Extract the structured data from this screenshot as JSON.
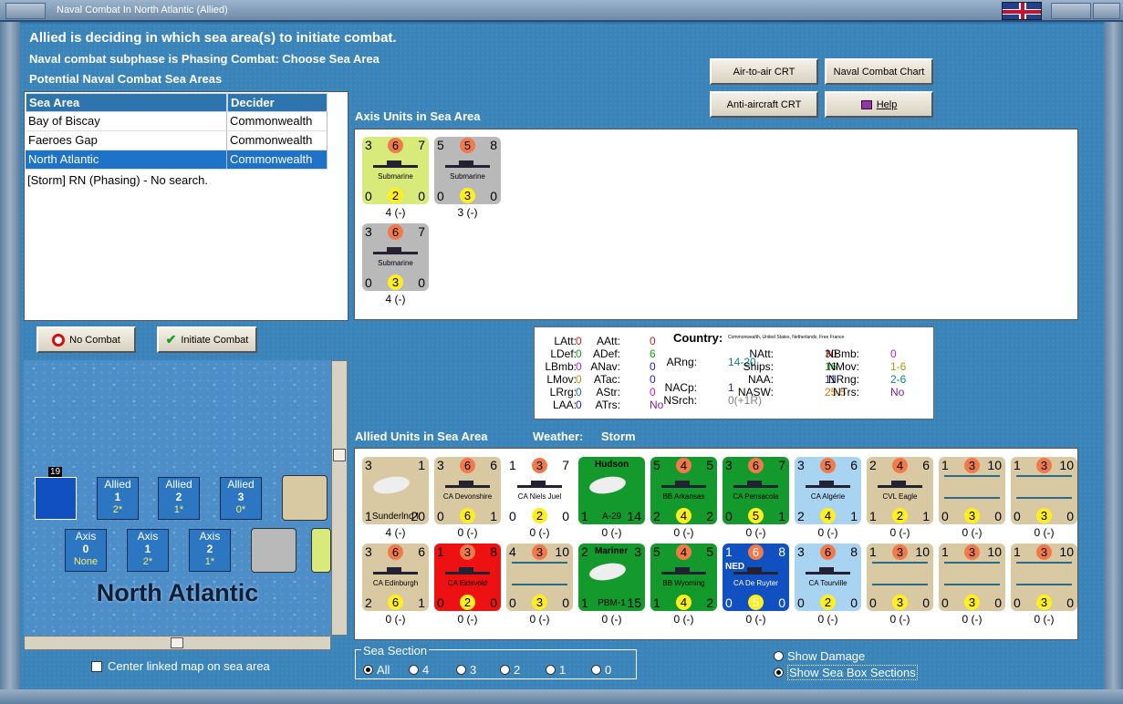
{
  "window": {
    "title": "Naval Combat In North Atlantic (Allied)"
  },
  "header": {
    "line1": "Allied is deciding in which sea area(s) to initiate combat.",
    "line2": "Naval combat subphase is Phasing Combat: Choose Sea Area",
    "line3": "Potential Naval Combat Sea Areas"
  },
  "sea_table": {
    "headers": [
      "Sea Area",
      "Decider"
    ],
    "rows": [
      [
        "Bay of Biscay",
        "Commonwealth"
      ],
      [
        "Faeroes Gap",
        "Commonwealth"
      ],
      [
        "North Atlantic",
        "Commonwealth"
      ]
    ],
    "selected": 2,
    "note": "[Storm]  RN (Phasing) - No search."
  },
  "buttons": {
    "air_crt": "Air-to-air CRT",
    "naval_chart": "Naval Combat Chart",
    "aa_crt": "Anti-aircraft CRT",
    "help": "Help",
    "no_combat": "No Combat",
    "initiate": "Initiate Combat"
  },
  "axis": {
    "label": "Axis Units in Sea Area",
    "units": [
      {
        "tl": "3",
        "tc": "6",
        "tr": "7",
        "name": "Submarine",
        "bl": "0",
        "bc": "2",
        "br": "0",
        "status": "4 (-)",
        "color": "#d8ea7a"
      },
      {
        "tl": "5",
        "tc": "5",
        "tr": "8",
        "name": "Submarine",
        "bl": "0",
        "bc": "3",
        "br": "0",
        "status": "3 (-)",
        "color": "#b9b9b9"
      },
      {
        "tl": "3",
        "tc": "6",
        "tr": "7",
        "name": "Submarine",
        "bl": "0",
        "bc": "3",
        "br": "0",
        "status": "4 (-)",
        "color": "#b9b9b9"
      }
    ]
  },
  "info": {
    "country_label": "Country:",
    "country": "Commonwealth, United States, Netherlands, Free France",
    "stats": [
      {
        "k": "LAtt:",
        "v": "0",
        "c": "#d02020"
      },
      {
        "k": "LDef:",
        "v": "0",
        "c": "#10a010"
      },
      {
        "k": "LBmb:",
        "v": "0",
        "c": "#c020c0"
      },
      {
        "k": "LMov:",
        "v": "0",
        "c": "#a0a010"
      },
      {
        "k": "LRrg:",
        "v": "0",
        "c": "#108080"
      },
      {
        "k": "LAA:",
        "v": "0",
        "c": "#2020c0"
      },
      {
        "k": "AAtt:",
        "v": "0",
        "c": "#d02020"
      },
      {
        "k": "ADef:",
        "v": "6",
        "c": "#10a010"
      },
      {
        "k": "ANav:",
        "v": "0",
        "c": "#2020c0"
      },
      {
        "k": "ATac:",
        "v": "0",
        "c": "#2020c0"
      },
      {
        "k": "AStr:",
        "v": "0",
        "c": "#c020c0"
      },
      {
        "k": "ATrs:",
        "v": "No",
        "c": "#8020a0"
      },
      {
        "k": "ARng:",
        "v": "14-20",
        "c": "#108080"
      },
      {
        "k": "NACp:",
        "v": "1",
        "c": "#2020c0"
      },
      {
        "k": "NSrch:",
        "v": "0(+1R)",
        "c": "#808080"
      },
      {
        "k": "NAtt:",
        "v": "30",
        "c": "#d02020"
      },
      {
        "k": "Ships:",
        "v": "16",
        "c": "#10a010"
      },
      {
        "k": "NAA:",
        "v": "11",
        "c": "#2020c0"
      },
      {
        "k": "NASW:",
        "v": "25.5",
        "c": "#e07010"
      },
      {
        "k": "NBmb:",
        "v": "0",
        "c": "#c020c0"
      },
      {
        "k": "NMov:",
        "v": "1-6",
        "c": "#a0a010"
      },
      {
        "k": "NRng:",
        "v": "2-6",
        "c": "#108080"
      },
      {
        "k": "NTrs:",
        "v": "No",
        "c": "#8020a0"
      }
    ]
  },
  "allied": {
    "label": "Allied Units in Sea Area",
    "weather_label": "Weather:",
    "weather": "Storm",
    "units": [
      {
        "tl": "3",
        "tc": "",
        "tr": "1",
        "name": "Sunderlnd I",
        "bl": "1",
        "bc": "",
        "br": "20",
        "status": "4 (-)",
        "color": "#d9c9a3",
        "type": "air"
      },
      {
        "tl": "3",
        "tc": "6",
        "tr": "6",
        "name": "CA Devonshire",
        "bl": "0",
        "bc": "6",
        "br": "1",
        "status": "0 (-)",
        "color": "#d9c9a3"
      },
      {
        "tl": "1",
        "tc": "3",
        "tr": "7",
        "name": "CA Niels Juel",
        "bl": "0",
        "bc": "2",
        "br": "0",
        "status": "0 (-)",
        "color": "#ffffff"
      },
      {
        "tl": "",
        "tc": "Hudson",
        "tr": "",
        "name": "A-29",
        "bl": "1",
        "bc": "",
        "br": "14",
        "status": "0 (-)",
        "color": "#149a2c",
        "type": "air"
      },
      {
        "tl": "5",
        "tc": "4",
        "tr": "5",
        "name": "BB Arkansas",
        "bl": "2",
        "bc": "4",
        "br": "2",
        "status": "0 (-)",
        "color": "#149a2c"
      },
      {
        "tl": "3",
        "tc": "6",
        "tr": "7",
        "name": "CA Pensacola",
        "bl": "0",
        "bc": "5",
        "br": "1",
        "status": "0 (-)",
        "color": "#149a2c"
      },
      {
        "tl": "3",
        "tc": "5",
        "tr": "6",
        "name": "CA Algérie",
        "bl": "2",
        "bc": "4",
        "br": "1",
        "status": "0 (-)",
        "color": "#a8d4f2"
      },
      {
        "tl": "2",
        "tc": "4",
        "tr": "6",
        "name": "CVL Eagle",
        "bl": "1",
        "bc": "2",
        "br": "1",
        "status": "0 (-)",
        "color": "#d9c9a3"
      },
      {
        "tl": "1",
        "tc": "3",
        "tr": "10",
        "name": "",
        "bl": "0",
        "bc": "3",
        "br": "0",
        "status": "0 (-)",
        "color": "#d9c9a3",
        "type": "conv"
      },
      {
        "tl": "1",
        "tc": "3",
        "tr": "10",
        "name": "",
        "bl": "0",
        "bc": "3",
        "br": "0",
        "status": "0 (-)",
        "color": "#d9c9a3",
        "type": "conv"
      },
      {
        "tl": "3",
        "tc": "6",
        "tr": "6",
        "name": "CA Edinburgh",
        "bl": "2",
        "bc": "6",
        "br": "1",
        "status": "0 (-)",
        "color": "#d9c9a3"
      },
      {
        "tl": "1",
        "tc": "3",
        "tr": "8",
        "name": "CA Eidsvold",
        "bl": "0",
        "bc": "2",
        "br": "0",
        "status": "0 (-)",
        "color": "#ee1111"
      },
      {
        "tl": "4",
        "tc": "3",
        "tr": "10",
        "name": "",
        "bl": "0",
        "bc": "3",
        "br": "0",
        "status": "0 (-)",
        "color": "#d9c9a3",
        "type": "conv"
      },
      {
        "tl": "2",
        "tc": "Mariner",
        "tr": "3",
        "name": "PBM-1",
        "bl": "1",
        "bc": "",
        "br": "15",
        "status": "0 (-)",
        "color": "#149a2c",
        "type": "air"
      },
      {
        "tl": "5",
        "tc": "4",
        "tr": "5",
        "name": "BB Wyoming",
        "bl": "1",
        "bc": "4",
        "br": "2",
        "status": "0 (-)",
        "color": "#149a2c"
      },
      {
        "tl": "1",
        "tc": "6",
        "tr": "8",
        "name": "CA De Ruyter",
        "bl": "0",
        "bc": "5",
        "br": "0",
        "status": "0 (-)",
        "color": "#1050c0",
        "ned": "NED"
      },
      {
        "tl": "3",
        "tc": "6",
        "tr": "8",
        "name": "CA Tourville",
        "bl": "0",
        "bc": "2",
        "br": "0",
        "status": "0 (-)",
        "color": "#a8d4f2"
      },
      {
        "tl": "1",
        "tc": "3",
        "tr": "10",
        "name": "",
        "bl": "0",
        "bc": "3",
        "br": "0",
        "status": "0 (-)",
        "color": "#d9c9a3",
        "type": "conv"
      },
      {
        "tl": "1",
        "tc": "3",
        "tr": "10",
        "name": "",
        "bl": "0",
        "bc": "3",
        "br": "0",
        "status": "0 (-)",
        "color": "#d9c9a3",
        "type": "conv"
      },
      {
        "tl": "1",
        "tc": "3",
        "tr": "10",
        "name": "",
        "bl": "0",
        "bc": "3",
        "br": "0",
        "status": "0 (-)",
        "color": "#d9c9a3",
        "type": "conv"
      }
    ]
  },
  "map": {
    "title": "North Atlantic",
    "stack_count": "19",
    "boxes_allied": [
      {
        "label": "Allied",
        "n": "1",
        "v": "2*"
      },
      {
        "label": "Allied",
        "n": "2",
        "v": "1*"
      },
      {
        "label": "Allied",
        "n": "3",
        "v": "0*"
      }
    ],
    "boxes_axis": [
      {
        "label": "Axis",
        "n": "0",
        "v": "None"
      },
      {
        "label": "Axis",
        "n": "1",
        "v": "2*"
      },
      {
        "label": "Axis",
        "n": "2",
        "v": "1*"
      }
    ]
  },
  "center_map": "Center linked map on sea area",
  "sea_section": {
    "label": "Sea Section",
    "options": [
      "All",
      "4",
      "3",
      "2",
      "1",
      "0"
    ]
  },
  "display_opts": {
    "show_damage": "Show Damage",
    "show_boxes": "Show Sea Box Sections"
  }
}
